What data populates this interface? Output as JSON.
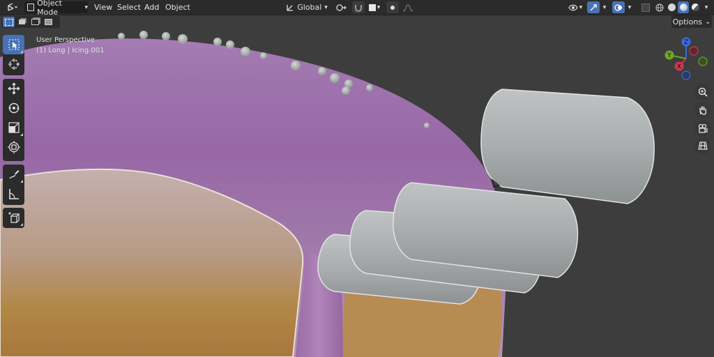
{
  "header": {
    "mode_label": "Object Mode",
    "menus": [
      "View",
      "Select",
      "Add",
      "Object"
    ],
    "transform_orientation": "Global",
    "options_label": "Options",
    "options_chevron": "⌄"
  },
  "viewport": {
    "perspective_label": "User Perspective",
    "object_label": "(1) Long | Icing.001"
  },
  "gizmo": {
    "axes": [
      {
        "label": "Z",
        "color": "#3b6bd6"
      },
      {
        "label": "Y",
        "color": "#6ea72a"
      },
      {
        "label": "X",
        "color": "#d0384b"
      }
    ]
  },
  "tools": [
    "select-box",
    "cursor",
    "move",
    "rotate",
    "scale",
    "transform",
    "annotate",
    "measure",
    "add-cube"
  ],
  "nav_icons": [
    "zoom-icon",
    "pan-hand-icon",
    "camera-icon",
    "grid-ortho-icon"
  ],
  "colors": {
    "header_bg": "#2b2b2b",
    "accent": "#4772b3",
    "icing_purple": "#a77bb0",
    "cake_tan": "#b58a52",
    "sprinkle_gray": "#c2c6c6"
  }
}
